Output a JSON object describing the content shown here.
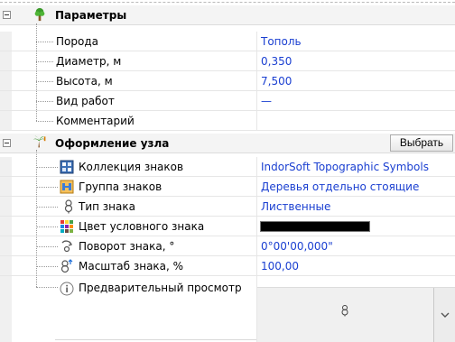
{
  "categories": [
    {
      "title": "Параметры",
      "rows": [
        {
          "label": "Порода",
          "value": "Тополь"
        },
        {
          "label": "Диаметр, м",
          "value": "0,350"
        },
        {
          "label": "Высота, м",
          "value": "7,500"
        },
        {
          "label": "Вид работ",
          "value": "—"
        },
        {
          "label": "Комментарий",
          "value": ""
        }
      ]
    },
    {
      "title": "Оформление узла",
      "button_label": "Выбрать",
      "rows": [
        {
          "label": "Коллекция знаков",
          "value": "IndorSoft Topographic Symbols"
        },
        {
          "label": "Группа знаков",
          "value": "Деревья отдельно стоящие"
        },
        {
          "label": "Тип знака",
          "value": "Лиственные"
        },
        {
          "label": "Цвет условного знака",
          "value": ""
        },
        {
          "label": "Поворот знака, °",
          "value": "0°00'00,000\""
        },
        {
          "label": "Масштаб знака, %",
          "value": "100,00"
        },
        {
          "label": "Предварительный просмотр",
          "value": ""
        }
      ]
    }
  ],
  "swatch_color": "#000000",
  "value_color": "#1a3fd1",
  "icons": [
    "expander-minus-icon",
    "tree-icon",
    "palm-tree-icon",
    "grid-collection-icon",
    "group-icon",
    "symbol-icon",
    "color-palette-icon",
    "rotate-icon",
    "scale-icon",
    "info-icon",
    "tree-preview-icon",
    "chevron-down-icon"
  ]
}
